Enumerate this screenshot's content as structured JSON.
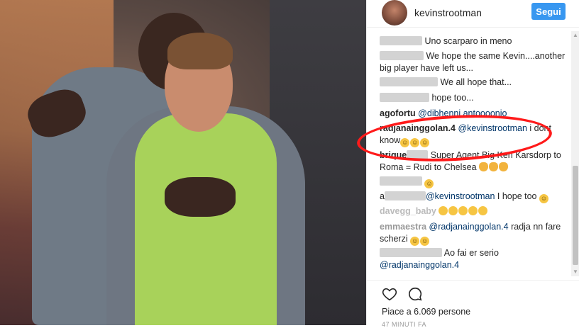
{
  "post": {
    "username": "kevinstrootman",
    "follow_label": "Segui"
  },
  "comments": [
    {
      "user": "",
      "blur_width": 60,
      "text": "Uno scarparo in meno"
    },
    {
      "user": "",
      "blur_width": 62,
      "text": "We hope the same Kevin....another big player have left us..."
    },
    {
      "user": "",
      "blur_width": 82,
      "text": "We all hope that..."
    },
    {
      "user": "",
      "blur_width": 70,
      "text": "hope too..."
    },
    {
      "user": "agofortu",
      "mention": "@dibhenni antoooonio",
      "text": ""
    },
    {
      "user": "radjanainggolan.4",
      "mention": "@kevinstrootman",
      "text": "i dont know"
    },
    {
      "user": "brique",
      "blur_width": 30,
      "text": "Super Agent Big Ken Karsdorp to Roma = Rudi to Chelsea"
    },
    {
      "user": "",
      "blur_width": 60,
      "text": ""
    },
    {
      "user": "a",
      "blur_width": 58,
      "mention": "@kevinstrootman",
      "text": "I hope too"
    },
    {
      "user": "davegg_baby",
      "text": ""
    },
    {
      "user": "emmaestra",
      "mention": "@radjanainggolan.4",
      "text": "radja nn fare scherzi"
    },
    {
      "user": "",
      "blur_width": 88,
      "text": "Ao fai er serio",
      "mention2": "@radjanainggolan.4"
    }
  ],
  "likes": "Piace a 6.069 persone",
  "timestamp": "47 MINUTI FA",
  "icons": {
    "heart": "heart-icon",
    "comment": "comment-bubble-icon",
    "scroll_up": "scroll-up-arrow-icon",
    "scroll_down": "scroll-down-arrow-icon"
  },
  "colors": {
    "follow_button": "#3897f0",
    "highlight_circle": "#ff1a1a",
    "mention": "#003569"
  }
}
